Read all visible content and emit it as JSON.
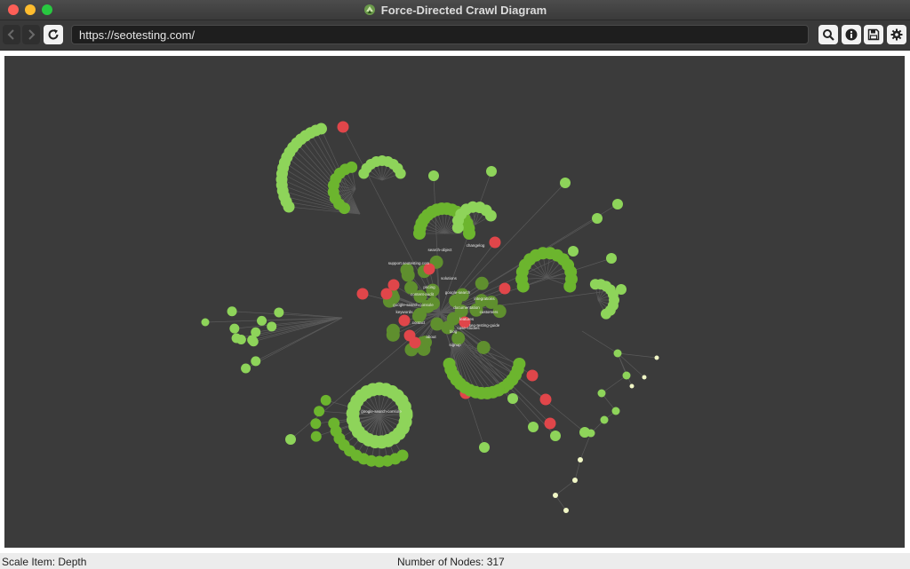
{
  "window": {
    "title": "Force-Directed Crawl Diagram"
  },
  "toolbar": {
    "url": "https://seotesting.com/",
    "buttons": {
      "back_icon": "chevron-left-icon",
      "forward_icon": "chevron-right-icon",
      "reload_icon": "reload-icon",
      "search_icon": "search-icon",
      "info_icon": "info-icon",
      "save_icon": "save-icon",
      "settings_icon": "gear-icon"
    }
  },
  "status": {
    "scale_item": "Scale Item: Depth",
    "node_count": "Number of Nodes: 317"
  },
  "graph": {
    "colors": {
      "background": "#3b3b3b",
      "edge": "#5a5a5a",
      "root": "#5f8f2e",
      "indexable": "#6cb52e",
      "indexable_deep": "#8ed45a",
      "non_indexable": "#e0464a",
      "leaf": "#f1f7c6"
    },
    "labels": [
      "support.seotesting.com",
      "search-object",
      "changelog",
      "google-search",
      "pricing",
      "content-audit",
      "google-search-console",
      "keywords",
      "integrations",
      "customers",
      "features",
      "blog",
      "about",
      "contact",
      "solutions",
      "signup",
      "case-studies",
      "seo-testing-guide",
      "documentation",
      "google-search-console"
    ]
  }
}
